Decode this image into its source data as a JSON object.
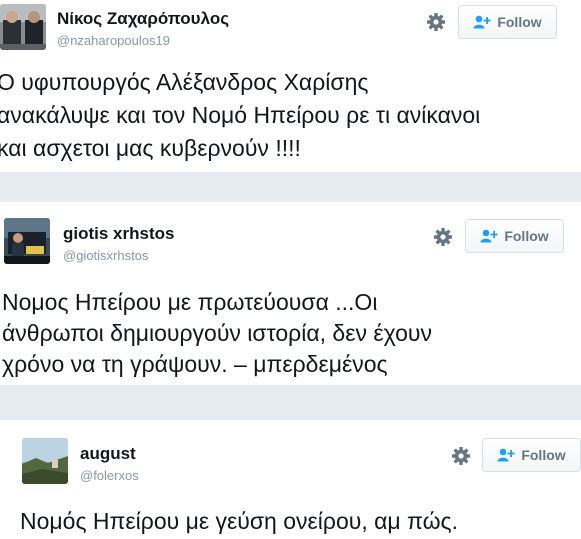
{
  "tweets": [
    {
      "author": "Νίκος Ζαχαρόπουλος",
      "handle": "@nzaharopoulos19",
      "follow_label": "Follow",
      "text_lines": [
        "Ο υφυπουργός Αλέξανδρος Χαρίσης",
        "ανακάλυψε και τον Νομό Ηπείρου ρε τι ανίκανοι",
        "και ασχετοι μας κυβερνούν !!!!"
      ]
    },
    {
      "author": "giotis xrhstos",
      "handle": "@giotisxrhstos",
      "follow_label": "Follow",
      "text_lines": [
        "Νομος  Ηπείρου με πρωτεύουσα ...Οι",
        "άνθρωποι δημιουργούν ιστορία, δεν έχουν",
        "χρόνο να τη γράψουν. – μπερδεμένος"
      ]
    },
    {
      "author": "august",
      "handle": "@folerxos",
      "follow_label": "Follow",
      "text_lines": [
        "Νομός Ηπείρου με γεύση ονείρου, αμ πώς."
      ]
    }
  ],
  "icons": {
    "settings": "gear-icon",
    "follow": "add-user-icon"
  },
  "colors": {
    "separator": "#e6ecf0",
    "handle": "#8899a6",
    "follow_text": "#66757f",
    "follow_icon": "#1da1f2"
  }
}
